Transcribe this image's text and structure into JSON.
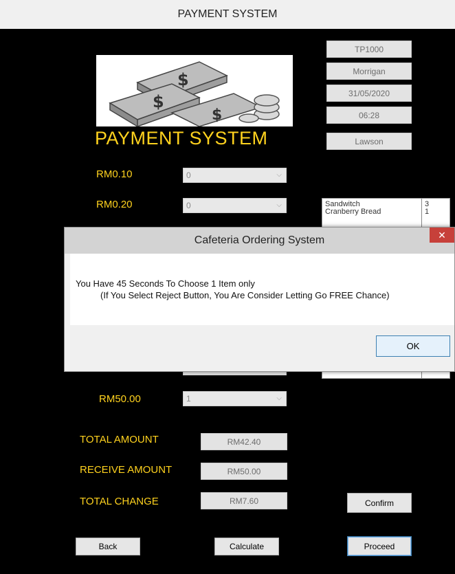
{
  "window": {
    "title": "PAYMENT SYSTEM"
  },
  "header": {
    "big_title": "PAYMENT SYSTEM"
  },
  "info": {
    "id": "TP1000",
    "name": "Morrigan",
    "date": "31/05/2020",
    "time": "06:28",
    "cashier": "Lawson"
  },
  "denominations": [
    {
      "label": "RM0.10",
      "value": "0"
    },
    {
      "label": "RM0.20",
      "value": "0"
    },
    {
      "label": "RM50.00",
      "value": "1"
    }
  ],
  "order_list": [
    {
      "name": "Sandwitch",
      "qty": "3"
    },
    {
      "name": "Cranberry Bread",
      "qty": "1"
    }
  ],
  "totals": {
    "total_label": "TOTAL AMOUNT",
    "total_value": "RM42.40",
    "receive_label": "RECEIVE AMOUNT",
    "receive_value": "RM50.00",
    "change_label": "TOTAL CHANGE",
    "change_value": "RM7.60"
  },
  "buttons": {
    "confirm": "Confirm",
    "back": "Back",
    "calculate": "Calculate",
    "proceed": "Proceed"
  },
  "dialog": {
    "title": "Cafeteria Ordering System",
    "line1": "You Have 45 Seconds To Choose 1 Item only",
    "line2": "(If You Select Reject Button, You Are Consider Letting Go FREE Chance)",
    "ok": "OK"
  },
  "colors": {
    "label_yellow": "#ffd21e",
    "background": "#000000"
  }
}
